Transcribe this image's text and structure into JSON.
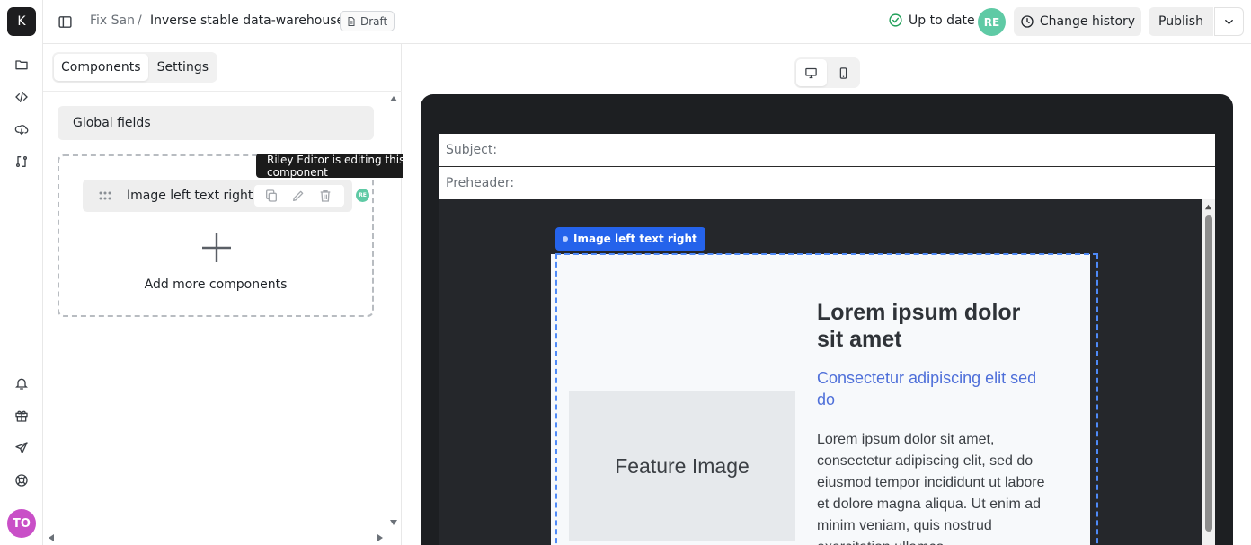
{
  "app": {
    "logo_letter": "K"
  },
  "rail": {
    "icons": [
      "folder-icon",
      "code-icon",
      "cloud-download-icon",
      "git-compare-icon",
      "bell-icon",
      "gift-icon",
      "send-icon",
      "life-buoy-icon"
    ],
    "user_initials": "TO",
    "user_color": "#c94fc7"
  },
  "header": {
    "breadcrumb": {
      "project": "Fix San",
      "separator": "/",
      "document": "Inverse stable data-warehouse"
    },
    "draft_label": "Draft",
    "status_text": "Up to date",
    "collaborator_initials": "RE",
    "collaborator_color": "#5fcaa5",
    "history_label": "Change history",
    "publish_label": "Publish"
  },
  "panel": {
    "tabs": [
      {
        "label": "Components",
        "active": true
      },
      {
        "label": "Settings",
        "active": false
      }
    ],
    "global_fields_label": "Global fields",
    "component": {
      "label": "Image left text right",
      "editor_initials": "RE"
    },
    "tooltip": "Riley Editor is editing this component",
    "add_more_label": "Add more components"
  },
  "preview": {
    "devices": [
      {
        "name": "desktop",
        "active": true
      },
      {
        "name": "mobile",
        "active": false
      }
    ],
    "subject_label": "Subject:",
    "preheader_label": "Preheader:",
    "selected_component_tag": "Image left text right",
    "accent_color": "#2563eb",
    "email": {
      "image_placeholder": "Feature Image",
      "title": "Lorem ipsum dolor sit amet",
      "subtitle": "Consectetur adipiscing elit sed do",
      "body": "Lorem ipsum dolor sit amet, consectetur adipiscing elit, sed do eiusmod tempor incididunt ut labore et dolore magna aliqua. Ut enim ad minim veniam, quis nostrud exercitation ullamco"
    }
  }
}
